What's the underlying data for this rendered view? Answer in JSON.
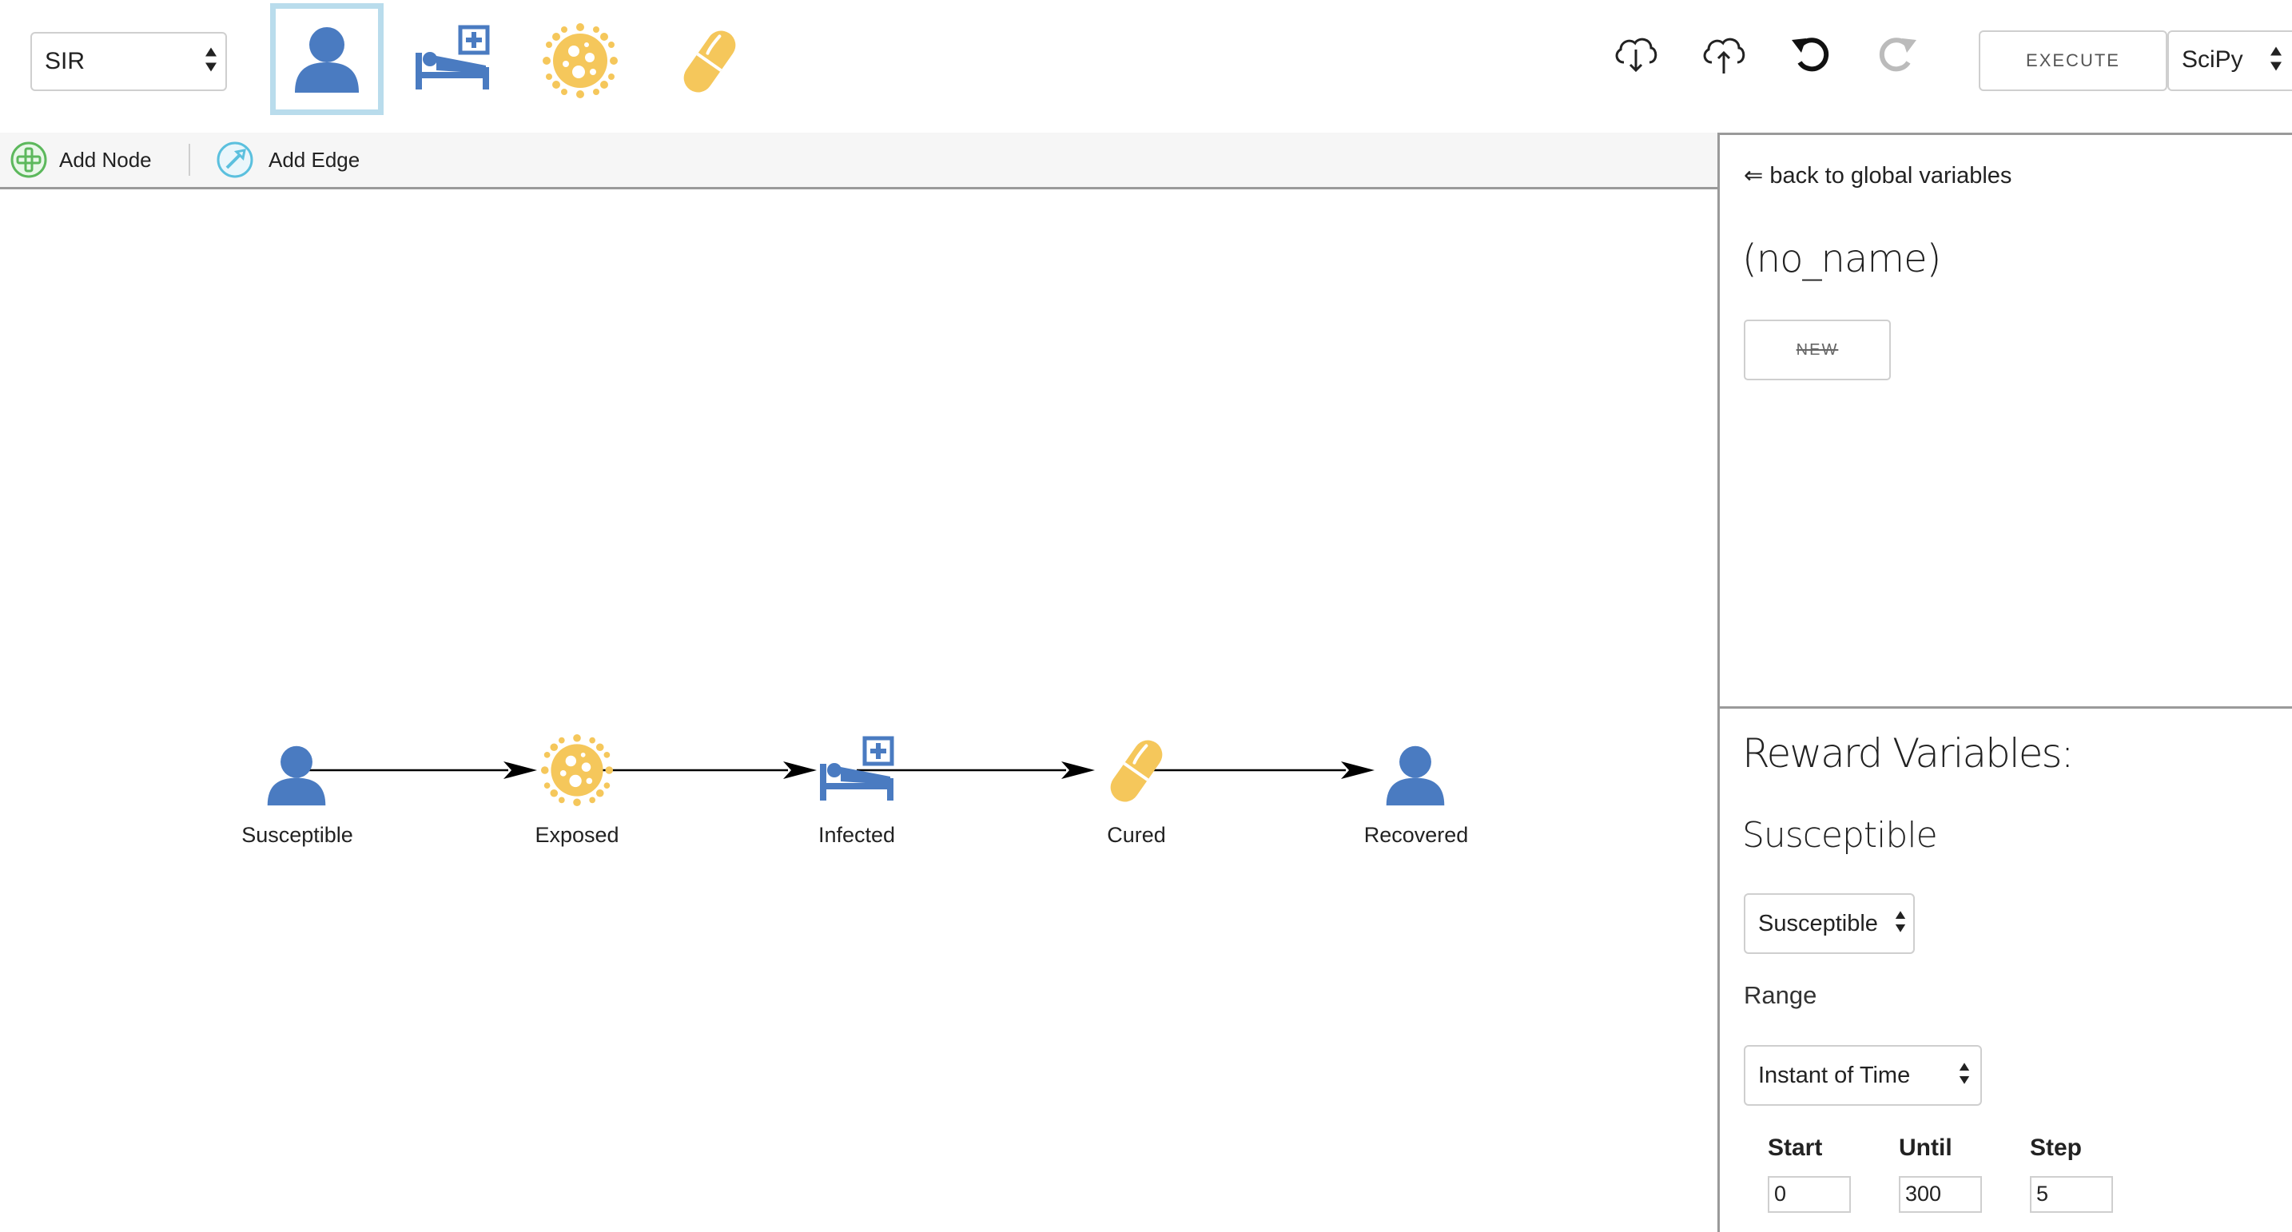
{
  "toolbar": {
    "model_select": {
      "value": "SIR"
    },
    "palette": [
      {
        "name": "person-icon",
        "selected": true,
        "color": "#4a7bc1"
      },
      {
        "name": "hospital-bed-icon",
        "selected": false,
        "color": "#4a7bc1"
      },
      {
        "name": "virus-icon",
        "selected": false,
        "color": "#f5c75b"
      },
      {
        "name": "pill-icon",
        "selected": false,
        "color": "#f5c75b"
      }
    ],
    "actions": [
      "download-cloud-icon",
      "upload-cloud-icon",
      "undo-icon",
      "redo-icon"
    ],
    "execute_label": "EXECUTE",
    "solver_select": {
      "value": "SciPy"
    }
  },
  "subbar": {
    "add_node_label": "Add Node",
    "add_edge_label": "Add Edge"
  },
  "graph": {
    "nodes": [
      {
        "label": "Susceptible",
        "icon": "person-icon"
      },
      {
        "label": "Exposed",
        "icon": "virus-icon"
      },
      {
        "label": "Infected",
        "icon": "hospital-bed-icon"
      },
      {
        "label": "Cured",
        "icon": "pill-icon"
      },
      {
        "label": "Recovered",
        "icon": "person-icon"
      }
    ],
    "edges": [
      [
        "Susceptible",
        "Exposed"
      ],
      [
        "Exposed",
        "Infected"
      ],
      [
        "Infected",
        "Cured"
      ],
      [
        "Cured",
        "Recovered"
      ]
    ]
  },
  "panel": {
    "back_link": "⇐ back to global variables",
    "name_heading": "(no_name)",
    "new_button": "NEW",
    "reward_heading": "Reward Variables:",
    "reward_name": "Susceptible",
    "reward_select": "Susceptible",
    "range_label": "Range",
    "range_select": "Instant of Time",
    "start_label": "Start",
    "until_label": "Until",
    "step_label": "Step",
    "start_value": "0",
    "until_value": "300",
    "step_value": "5"
  },
  "colors": {
    "blue": "#4a7bc1",
    "yellow": "#f5c75b",
    "selection": "#b9dcec",
    "add_node_green": "#5cb85c",
    "add_edge_blue": "#5bc0de"
  }
}
